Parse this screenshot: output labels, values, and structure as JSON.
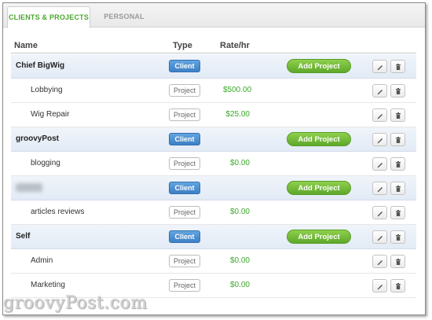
{
  "tabs": [
    {
      "label": "CLIENTS & PROJECTS",
      "active": true
    },
    {
      "label": "PERSONAL",
      "active": false
    }
  ],
  "columns": {
    "name": "Name",
    "type": "Type",
    "rate": "Rate/hr"
  },
  "rows": [
    {
      "kind": "client",
      "name": "Chief BigWig",
      "type": "Client",
      "rate": "",
      "action": "Add Project"
    },
    {
      "kind": "project",
      "name": "Lobbying",
      "type": "Project",
      "rate": "$500.00",
      "action": ""
    },
    {
      "kind": "project",
      "name": "Wig Repair",
      "type": "Project",
      "rate": "$25.00",
      "action": ""
    },
    {
      "kind": "client",
      "name": "groovyPost",
      "type": "Client",
      "rate": "",
      "action": "Add Project"
    },
    {
      "kind": "project",
      "name": "blogging",
      "type": "Project",
      "rate": "$0.00",
      "action": ""
    },
    {
      "kind": "client",
      "name": "",
      "blurred": true,
      "type": "Client",
      "rate": "",
      "action": "Add Project"
    },
    {
      "kind": "project",
      "name": "articles reviews",
      "type": "Project",
      "rate": "$0.00",
      "action": ""
    },
    {
      "kind": "client",
      "name": "Self",
      "type": "Client",
      "rate": "",
      "action": "Add Project"
    },
    {
      "kind": "project",
      "name": "Admin",
      "type": "Project",
      "rate": "$0.00",
      "action": ""
    },
    {
      "kind": "project",
      "name": "Marketing",
      "type": "Project",
      "rate": "$0.00",
      "action": ""
    }
  ],
  "icons": {
    "edit": "pencil-icon",
    "delete": "trash-icon"
  },
  "colors": {
    "accent_green": "#4aa52e",
    "client_blue": "#3c80c6",
    "rate_green": "#3aa82a"
  },
  "watermark": "groovyPost.com"
}
